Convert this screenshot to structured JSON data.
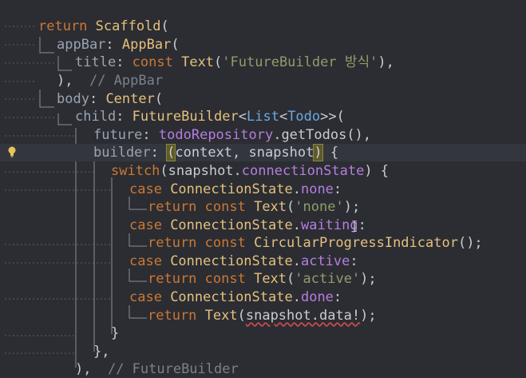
{
  "editor": {
    "background": "#2b2d33",
    "highlighted_line": 8,
    "lines": [
      {
        "tokens": [
          {
            "t": "return ",
            "c": "kw"
          },
          {
            "t": "Scaffold",
            "c": "cls"
          },
          {
            "t": "(",
            "c": "pun"
          }
        ]
      },
      {
        "tokens": [
          {
            "t": "appBar",
            "c": "prm"
          },
          {
            "t": ": ",
            "c": "pun"
          },
          {
            "t": "AppBar",
            "c": "cls"
          },
          {
            "t": "(",
            "c": "pun"
          }
        ]
      },
      {
        "tokens": [
          {
            "t": "title",
            "c": "prm"
          },
          {
            "t": ": ",
            "c": "pun"
          },
          {
            "t": "const ",
            "c": "kw"
          },
          {
            "t": "Text",
            "c": "cls"
          },
          {
            "t": "(",
            "c": "pun"
          },
          {
            "t": "'FutureBuilder 방식'",
            "c": "str"
          },
          {
            "t": "),",
            "c": "pun"
          }
        ]
      },
      {
        "tokens": [
          {
            "t": "),",
            "c": "pun"
          },
          {
            "t": "  // AppBar",
            "c": "cmt"
          }
        ]
      },
      {
        "tokens": [
          {
            "t": "body",
            "c": "prm"
          },
          {
            "t": ": ",
            "c": "pun"
          },
          {
            "t": "Center",
            "c": "cls"
          },
          {
            "t": "(",
            "c": "pun"
          }
        ]
      },
      {
        "tokens": [
          {
            "t": "child",
            "c": "prm"
          },
          {
            "t": ": ",
            "c": "pun"
          },
          {
            "t": "FutureBuilder",
            "c": "cls"
          },
          {
            "t": "<",
            "c": "pun"
          },
          {
            "t": "List",
            "c": "blu"
          },
          {
            "t": "<",
            "c": "pun"
          },
          {
            "t": "Todo",
            "c": "blu"
          },
          {
            "t": ">>(",
            "c": "pun"
          }
        ]
      },
      {
        "tokens": [
          {
            "t": "future",
            "c": "prm"
          },
          {
            "t": ": ",
            "c": "pun"
          },
          {
            "t": "todoRepository",
            "c": "prop"
          },
          {
            "t": ".getTodos(),",
            "c": "mono"
          }
        ]
      },
      {
        "tokens": [
          {
            "t": "builder",
            "c": "prm"
          },
          {
            "t": ": ",
            "c": "pun"
          },
          {
            "t": "(",
            "c": "brk"
          },
          {
            "t": "context, snapshot",
            "c": "mono"
          },
          {
            "t": ")",
            "c": "brk"
          },
          {
            "t": " {",
            "c": "pun"
          }
        ]
      },
      {
        "tokens": [
          {
            "t": "switch",
            "c": "kw"
          },
          {
            "t": "(snapshot.",
            "c": "mono"
          },
          {
            "t": "connectionState",
            "c": "prop"
          },
          {
            "t": ") {",
            "c": "pun"
          }
        ]
      },
      {
        "tokens": [
          {
            "t": "case ",
            "c": "kw"
          },
          {
            "t": "ConnectionState",
            "c": "cls"
          },
          {
            "t": ".",
            "c": "pun"
          },
          {
            "t": "none",
            "c": "prop"
          },
          {
            "t": ":",
            "c": "pun"
          }
        ]
      },
      {
        "tokens": [
          {
            "t": "return ",
            "c": "kw"
          },
          {
            "t": "const ",
            "c": "kw"
          },
          {
            "t": "Text",
            "c": "cls"
          },
          {
            "t": "(",
            "c": "pun"
          },
          {
            "t": "'none'",
            "c": "str"
          },
          {
            "t": ");",
            "c": "pun"
          }
        ]
      },
      {
        "tokens": [
          {
            "t": "case ",
            "c": "kw"
          },
          {
            "t": "ConnectionState",
            "c": "cls"
          },
          {
            "t": ".",
            "c": "pun"
          },
          {
            "t": "waiting",
            "c": "prop"
          },
          {
            "t": ":",
            "c": "pun"
          }
        ]
      },
      {
        "tokens": [
          {
            "t": "return ",
            "c": "kw"
          },
          {
            "t": "const ",
            "c": "kw"
          },
          {
            "t": "CircularProgressIndicator",
            "c": "cls"
          },
          {
            "t": "();",
            "c": "pun"
          }
        ]
      },
      {
        "tokens": [
          {
            "t": "case ",
            "c": "kw"
          },
          {
            "t": "ConnectionState",
            "c": "cls"
          },
          {
            "t": ".",
            "c": "pun"
          },
          {
            "t": "active",
            "c": "prop"
          },
          {
            "t": ":",
            "c": "pun"
          }
        ]
      },
      {
        "tokens": [
          {
            "t": "return ",
            "c": "kw"
          },
          {
            "t": "const ",
            "c": "kw"
          },
          {
            "t": "Text",
            "c": "cls"
          },
          {
            "t": "(",
            "c": "pun"
          },
          {
            "t": "'active'",
            "c": "str"
          },
          {
            "t": ");",
            "c": "pun"
          }
        ]
      },
      {
        "tokens": [
          {
            "t": "case ",
            "c": "kw"
          },
          {
            "t": "ConnectionState",
            "c": "cls"
          },
          {
            "t": ".",
            "c": "pun"
          },
          {
            "t": "done",
            "c": "prop"
          },
          {
            "t": ":",
            "c": "pun"
          }
        ]
      },
      {
        "tokens": [
          {
            "t": "return ",
            "c": "kw"
          },
          {
            "t": "Text",
            "c": "cls"
          },
          {
            "t": "(",
            "c": "pun"
          },
          {
            "t": "snapshot.data!",
            "c": "squig"
          },
          {
            "t": ");",
            "c": "pun"
          }
        ]
      },
      {
        "tokens": [
          {
            "t": "}",
            "c": "pun"
          }
        ]
      },
      {
        "tokens": [
          {
            "t": "},",
            "c": "pun"
          }
        ]
      },
      {
        "tokens": [
          {
            "t": "),",
            "c": "pun"
          },
          {
            "t": "  // FutureBuilder",
            "c": "cmt"
          }
        ]
      }
    ]
  },
  "icons": {
    "bulb": "lightbulb-icon",
    "cursor": "text-cursor-icon"
  }
}
